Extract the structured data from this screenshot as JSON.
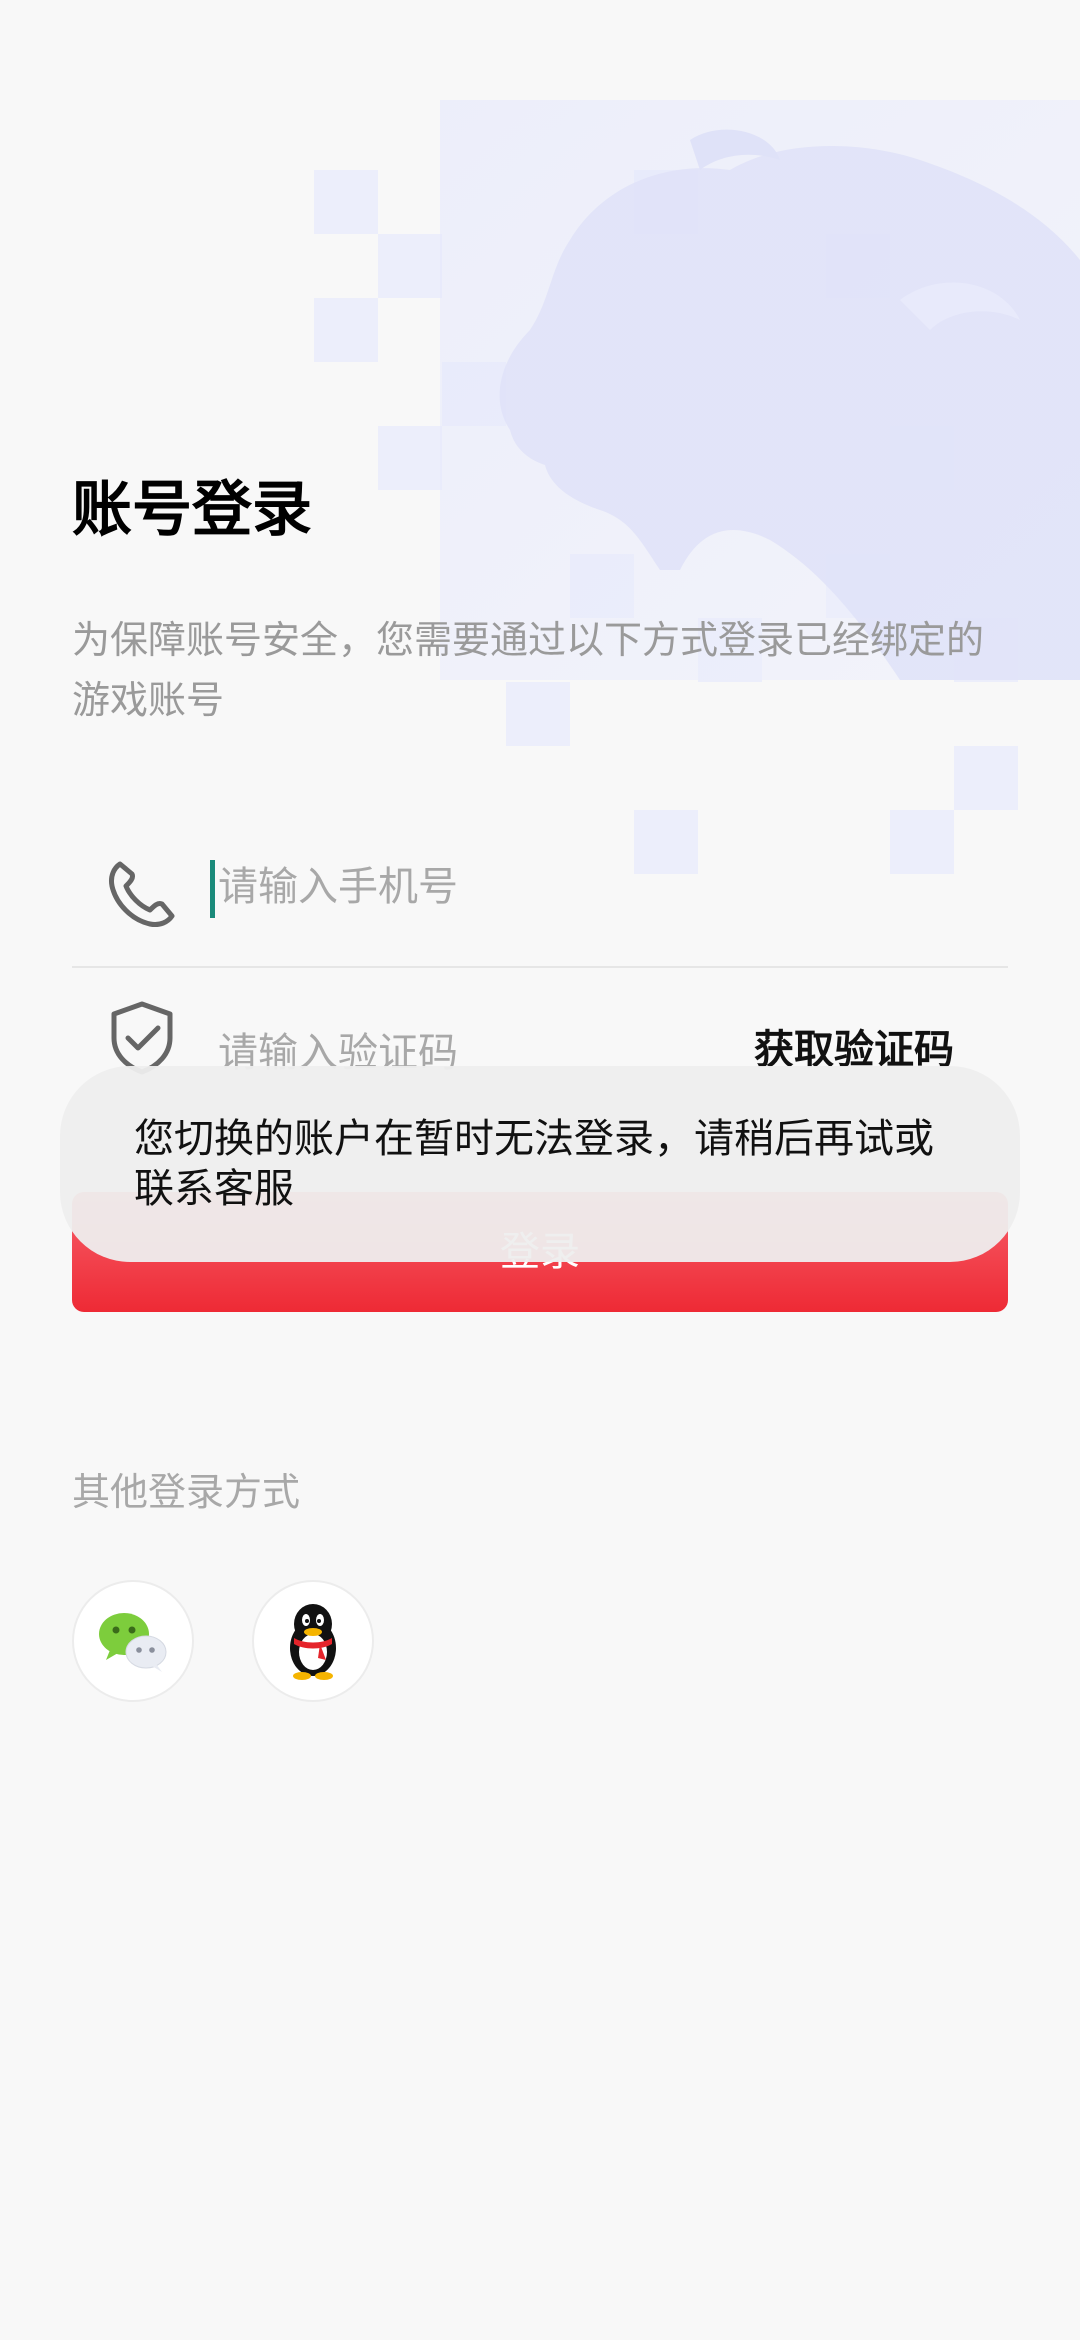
{
  "header": {
    "title": "账号登录",
    "description": "为保障账号安全，您需要通过以下方式登录已经绑定的游戏账号"
  },
  "form": {
    "phone_placeholder": "请输入手机号",
    "code_placeholder": "请输入验证码",
    "get_code_label": "获取验证码",
    "login_label": "登录"
  },
  "toast": {
    "message": "您切换的账户在暂时无法登录，请稍后再试或联系客服"
  },
  "other_login": {
    "title": "其他登录方式",
    "options": [
      {
        "icon": "wechat-icon"
      },
      {
        "icon": "qq-icon"
      }
    ]
  },
  "colors": {
    "accent": "#ee2a35",
    "cursor": "#1a8a7a",
    "muted_text": "#a8a8a8"
  }
}
